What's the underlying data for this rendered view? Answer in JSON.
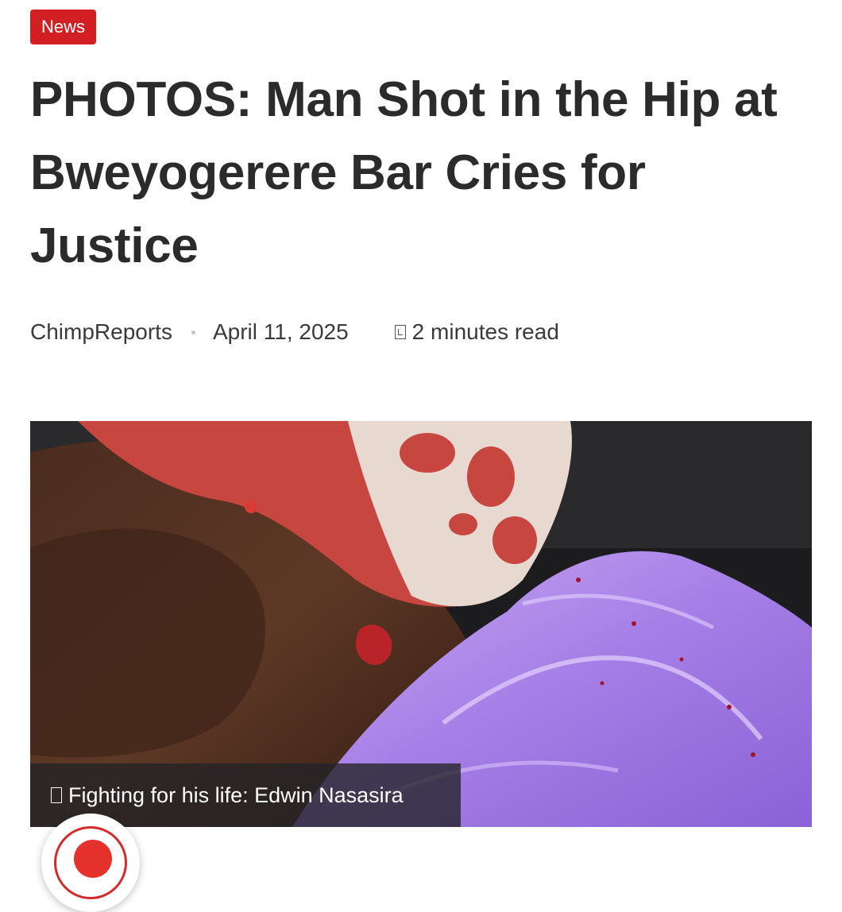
{
  "category_badge": "News",
  "article": {
    "title": "PHOTOS: Man Shot in the Hip at Bweyogerere Bar Cries for Justice",
    "author": "ChimpReports",
    "date": "April 11, 2025",
    "read_time": "2 minutes read"
  },
  "featured_image": {
    "caption": "Fighting for his life: Edwin Nasasira"
  },
  "colors": {
    "badge": "#d21f24",
    "title": "#2b2b2e",
    "caption_bg": "#232326"
  },
  "icons": [
    "clock-icon",
    "camera-icon",
    "notification-bell-icon"
  ]
}
